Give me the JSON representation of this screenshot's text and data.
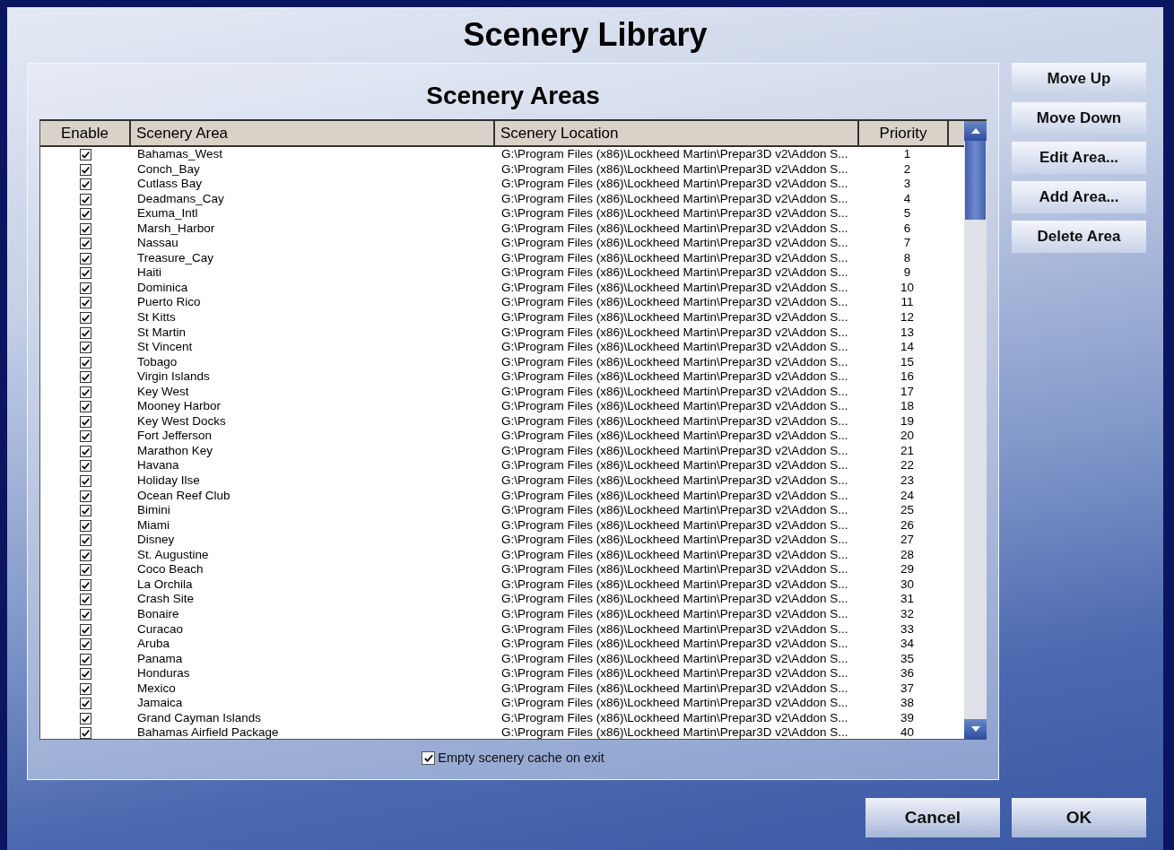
{
  "window": {
    "title": "Scenery Library"
  },
  "panel": {
    "title": "Scenery Areas"
  },
  "table": {
    "columns": [
      "Enable",
      "Scenery Area",
      "Scenery Location",
      "Priority"
    ],
    "rows": [
      {
        "enabled": true,
        "area": "Bahamas_West",
        "location": "G:\\Program Files (x86)\\Lockheed Martin\\Prepar3D v2\\Addon S...",
        "priority": "1"
      },
      {
        "enabled": true,
        "area": "Conch_Bay",
        "location": "G:\\Program Files (x86)\\Lockheed Martin\\Prepar3D v2\\Addon S...",
        "priority": "2"
      },
      {
        "enabled": true,
        "area": "Cutlass Bay",
        "location": "G:\\Program Files (x86)\\Lockheed Martin\\Prepar3D v2\\Addon S...",
        "priority": "3"
      },
      {
        "enabled": true,
        "area": "Deadmans_Cay",
        "location": "G:\\Program Files (x86)\\Lockheed Martin\\Prepar3D v2\\Addon S...",
        "priority": "4"
      },
      {
        "enabled": true,
        "area": "Exuma_Intl",
        "location": "G:\\Program Files (x86)\\Lockheed Martin\\Prepar3D v2\\Addon S...",
        "priority": "5"
      },
      {
        "enabled": true,
        "area": "Marsh_Harbor",
        "location": "G:\\Program Files (x86)\\Lockheed Martin\\Prepar3D v2\\Addon S...",
        "priority": "6"
      },
      {
        "enabled": true,
        "area": "Nassau",
        "location": "G:\\Program Files (x86)\\Lockheed Martin\\Prepar3D v2\\Addon S...",
        "priority": "7"
      },
      {
        "enabled": true,
        "area": "Treasure_Cay",
        "location": "G:\\Program Files (x86)\\Lockheed Martin\\Prepar3D v2\\Addon S...",
        "priority": "8"
      },
      {
        "enabled": true,
        "area": "Haiti",
        "location": "G:\\Program Files (x86)\\Lockheed Martin\\Prepar3D v2\\Addon S...",
        "priority": "9"
      },
      {
        "enabled": true,
        "area": "Dominica",
        "location": "G:\\Program Files (x86)\\Lockheed Martin\\Prepar3D v2\\Addon S...",
        "priority": "10"
      },
      {
        "enabled": true,
        "area": "Puerto Rico",
        "location": "G:\\Program Files (x86)\\Lockheed Martin\\Prepar3D v2\\Addon S...",
        "priority": "11"
      },
      {
        "enabled": true,
        "area": "St Kitts",
        "location": "G:\\Program Files (x86)\\Lockheed Martin\\Prepar3D v2\\Addon S...",
        "priority": "12"
      },
      {
        "enabled": true,
        "area": "St Martin",
        "location": "G:\\Program Files (x86)\\Lockheed Martin\\Prepar3D v2\\Addon S...",
        "priority": "13"
      },
      {
        "enabled": true,
        "area": "St Vincent",
        "location": "G:\\Program Files (x86)\\Lockheed Martin\\Prepar3D v2\\Addon S...",
        "priority": "14"
      },
      {
        "enabled": true,
        "area": "Tobago",
        "location": "G:\\Program Files (x86)\\Lockheed Martin\\Prepar3D v2\\Addon S...",
        "priority": "15"
      },
      {
        "enabled": true,
        "area": "Virgin Islands",
        "location": "G:\\Program Files (x86)\\Lockheed Martin\\Prepar3D v2\\Addon S...",
        "priority": "16"
      },
      {
        "enabled": true,
        "area": "Key West",
        "location": "G:\\Program Files (x86)\\Lockheed Martin\\Prepar3D v2\\Addon S...",
        "priority": "17"
      },
      {
        "enabled": true,
        "area": "Mooney Harbor",
        "location": "G:\\Program Files (x86)\\Lockheed Martin\\Prepar3D v2\\Addon S...",
        "priority": "18"
      },
      {
        "enabled": true,
        "area": "Key West Docks",
        "location": "G:\\Program Files (x86)\\Lockheed Martin\\Prepar3D v2\\Addon S...",
        "priority": "19"
      },
      {
        "enabled": true,
        "area": "Fort Jefferson",
        "location": "G:\\Program Files (x86)\\Lockheed Martin\\Prepar3D v2\\Addon S...",
        "priority": "20"
      },
      {
        "enabled": true,
        "area": "Marathon Key",
        "location": "G:\\Program Files (x86)\\Lockheed Martin\\Prepar3D v2\\Addon S...",
        "priority": "21"
      },
      {
        "enabled": true,
        "area": "Havana",
        "location": "G:\\Program Files (x86)\\Lockheed Martin\\Prepar3D v2\\Addon S...",
        "priority": "22"
      },
      {
        "enabled": true,
        "area": "Holiday Ilse",
        "location": "G:\\Program Files (x86)\\Lockheed Martin\\Prepar3D v2\\Addon S...",
        "priority": "23"
      },
      {
        "enabled": true,
        "area": "Ocean Reef Club",
        "location": "G:\\Program Files (x86)\\Lockheed Martin\\Prepar3D v2\\Addon S...",
        "priority": "24"
      },
      {
        "enabled": true,
        "area": "Bimini",
        "location": "G:\\Program Files (x86)\\Lockheed Martin\\Prepar3D v2\\Addon S...",
        "priority": "25"
      },
      {
        "enabled": true,
        "area": "Miami",
        "location": "G:\\Program Files (x86)\\Lockheed Martin\\Prepar3D v2\\Addon S...",
        "priority": "26"
      },
      {
        "enabled": true,
        "area": "Disney",
        "location": "G:\\Program Files (x86)\\Lockheed Martin\\Prepar3D v2\\Addon S...",
        "priority": "27"
      },
      {
        "enabled": true,
        "area": "St. Augustine",
        "location": "G:\\Program Files (x86)\\Lockheed Martin\\Prepar3D v2\\Addon S...",
        "priority": "28"
      },
      {
        "enabled": true,
        "area": "Coco Beach",
        "location": "G:\\Program Files (x86)\\Lockheed Martin\\Prepar3D v2\\Addon S...",
        "priority": "29"
      },
      {
        "enabled": true,
        "area": "La Orchila",
        "location": "G:\\Program Files (x86)\\Lockheed Martin\\Prepar3D v2\\Addon S...",
        "priority": "30"
      },
      {
        "enabled": true,
        "area": "Crash Site",
        "location": "G:\\Program Files (x86)\\Lockheed Martin\\Prepar3D v2\\Addon S...",
        "priority": "31"
      },
      {
        "enabled": true,
        "area": "Bonaire",
        "location": "G:\\Program Files (x86)\\Lockheed Martin\\Prepar3D v2\\Addon S...",
        "priority": "32"
      },
      {
        "enabled": true,
        "area": "Curacao",
        "location": "G:\\Program Files (x86)\\Lockheed Martin\\Prepar3D v2\\Addon S...",
        "priority": "33"
      },
      {
        "enabled": true,
        "area": "Aruba",
        "location": "G:\\Program Files (x86)\\Lockheed Martin\\Prepar3D v2\\Addon S...",
        "priority": "34"
      },
      {
        "enabled": true,
        "area": "Panama",
        "location": "G:\\Program Files (x86)\\Lockheed Martin\\Prepar3D v2\\Addon S...",
        "priority": "35"
      },
      {
        "enabled": true,
        "area": "Honduras",
        "location": "G:\\Program Files (x86)\\Lockheed Martin\\Prepar3D v2\\Addon S...",
        "priority": "36"
      },
      {
        "enabled": true,
        "area": "Mexico",
        "location": "G:\\Program Files (x86)\\Lockheed Martin\\Prepar3D v2\\Addon S...",
        "priority": "37"
      },
      {
        "enabled": true,
        "area": "Jamaica",
        "location": "G:\\Program Files (x86)\\Lockheed Martin\\Prepar3D v2\\Addon S...",
        "priority": "38"
      },
      {
        "enabled": true,
        "area": "Grand Cayman Islands",
        "location": "G:\\Program Files (x86)\\Lockheed Martin\\Prepar3D v2\\Addon S...",
        "priority": "39"
      },
      {
        "enabled": true,
        "area": "Bahamas Airfield Package",
        "location": "G:\\Program Files (x86)\\Lockheed Martin\\Prepar3D v2\\Addon S...",
        "priority": "40"
      }
    ]
  },
  "cache_option": {
    "label": "Empty scenery cache on exit",
    "checked": true
  },
  "side_buttons": [
    "Move Up",
    "Move Down",
    "Edit Area...",
    "Add Area...",
    "Delete Area"
  ],
  "footer_buttons": [
    "Cancel",
    "OK"
  ]
}
